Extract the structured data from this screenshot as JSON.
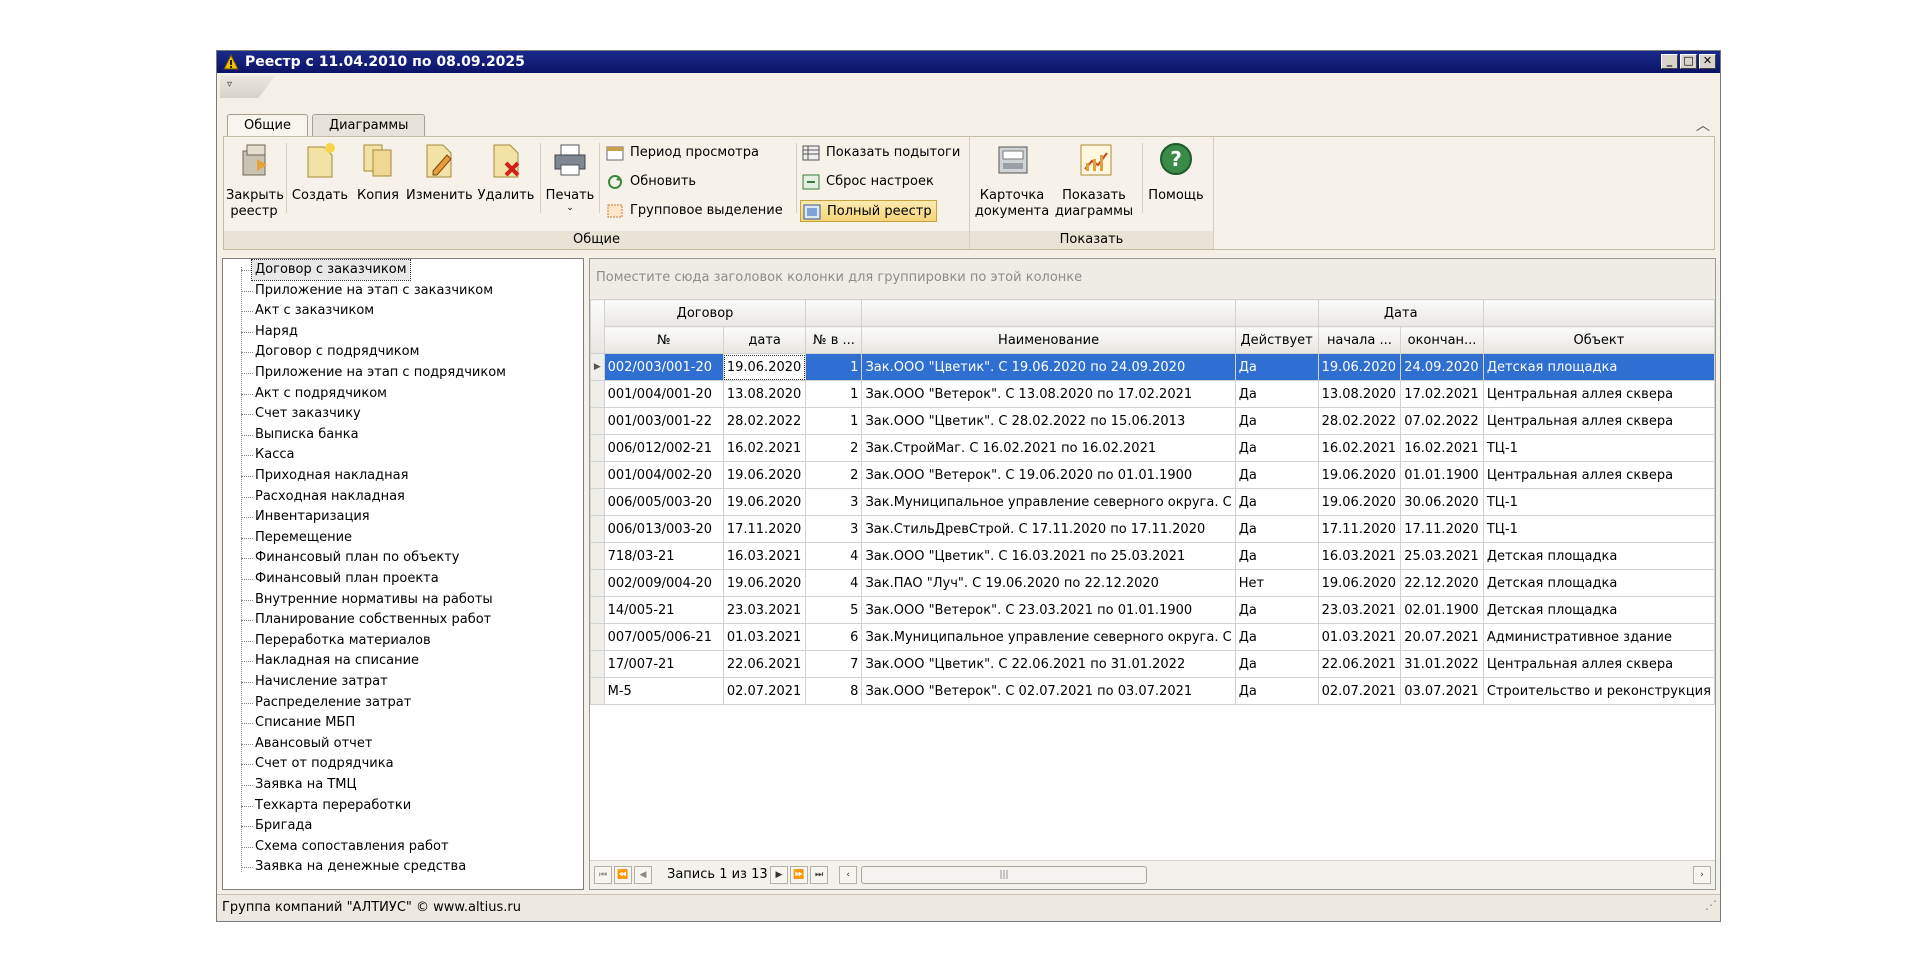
{
  "window": {
    "title": "Реестр с 11.04.2010 по 08.09.2025"
  },
  "ribbon": {
    "tabs": [
      "Общие",
      "Диаграммы"
    ],
    "groups": {
      "general": "Общие",
      "show": "Показать"
    },
    "buttons": {
      "close": "Закрыть реестр",
      "create": "Создать",
      "copy": "Копия",
      "edit": "Изменить",
      "delete": "Удалить",
      "print": "Печать",
      "period": "Период просмотра",
      "refresh": "Обновить",
      "group_select": "Групповое выделение",
      "totals": "Показать подытоги",
      "reset": "Сброс настроек",
      "full_registry": "Полный реестр",
      "card": "Карточка документа",
      "charts": "Показать диаграммы",
      "help": "Помощь"
    }
  },
  "tree": {
    "items": [
      "Договор с заказчиком",
      "Приложение на этап с заказчиком",
      "Акт с заказчиком",
      "Наряд",
      "Договор с подрядчиком",
      "Приложение на этап с подрядчиком",
      "Акт с подрядчиком",
      "Счет заказчику",
      "Выписка банка",
      "Касса",
      "Приходная накладная",
      "Расходная накладная",
      "Инвентаризация",
      "Перемещение",
      "Финансовый план по объекту",
      "Финансовый план проекта",
      "Внутренние нормативы на работы",
      "Планирование собственных работ",
      "Переработка материалов",
      "Накладная на списание",
      "Начисление затрат",
      "Распределение затрат",
      "Списание МБП",
      "Авансовый отчет",
      "Счет от подрядчика",
      "Заявка на ТМЦ",
      "Техкарта переработки",
      "Бригада",
      "Схема сопоставления работ",
      "Заявка на денежные средства"
    ],
    "selected_index": 0
  },
  "grid": {
    "group_panel_hint": "Поместите сюда заголовок колонки для группировки по этой колонке",
    "band_contract": "Договор",
    "band_date": "Дата",
    "columns": [
      "№",
      "дата",
      "№ в ...",
      "Наименование",
      "Действует",
      "начала ...",
      "окончан...",
      "Объект"
    ],
    "rows": [
      [
        "002/003/001-20",
        "19.06.2020",
        "1",
        "Зак.ООО \"Цветик\". С 19.06.2020 по 24.09.2020",
        "Да",
        "19.06.2020",
        "24.09.2020",
        "Детская площадка"
      ],
      [
        "001/004/001-20",
        "13.08.2020",
        "1",
        "Зак.ООО \"Ветерок\". С 13.08.2020 по 17.02.2021",
        "Да",
        "13.08.2020",
        "17.02.2021",
        "Центральная аллея сквера"
      ],
      [
        "001/003/001-22",
        "28.02.2022",
        "1",
        "Зак.ООО \"Цветик\". С 28.02.2022 по 15.06.2013",
        "Да",
        "28.02.2022",
        "07.02.2022",
        "Центральная аллея сквера"
      ],
      [
        "006/012/002-21",
        "16.02.2021",
        "2",
        "Зак.СтройМаг. С 16.02.2021 по 16.02.2021",
        "Да",
        "16.02.2021",
        "16.02.2021",
        "ТЦ-1"
      ],
      [
        "001/004/002-20",
        "19.06.2020",
        "2",
        "Зак.ООО \"Ветерок\". С 19.06.2020 по 01.01.1900",
        "Да",
        "19.06.2020",
        "01.01.1900",
        "Центральная аллея сквера"
      ],
      [
        "006/005/003-20",
        "19.06.2020",
        "3",
        "Зак.Муниципальное управление северного округа. С",
        "Да",
        "19.06.2020",
        "30.06.2020",
        "ТЦ-1"
      ],
      [
        "006/013/003-20",
        "17.11.2020",
        "3",
        "Зак.СтильДревСтрой. С 17.11.2020 по 17.11.2020",
        "Да",
        "17.11.2020",
        "17.11.2020",
        "ТЦ-1"
      ],
      [
        "718/03-21",
        "16.03.2021",
        "4",
        "Зак.ООО \"Цветик\". С 16.03.2021 по 25.03.2021",
        "Да",
        "16.03.2021",
        "25.03.2021",
        "Детская площадка"
      ],
      [
        "002/009/004-20",
        "19.06.2020",
        "4",
        "Зак.ПАО \"Луч\". С 19.06.2020 по 22.12.2020",
        "Нет",
        "19.06.2020",
        "22.12.2020",
        "Детская площадка"
      ],
      [
        "14/005-21",
        "23.03.2021",
        "5",
        "Зак.ООО \"Ветерок\". С 23.03.2021 по 01.01.1900",
        "Да",
        "23.03.2021",
        "02.01.1900",
        "Детская площадка"
      ],
      [
        "007/005/006-21",
        "01.03.2021",
        "6",
        "Зак.Муниципальное управление северного округа. С",
        "Да",
        "01.03.2021",
        "20.07.2021",
        "Административное здание"
      ],
      [
        "17/007-21",
        "22.06.2021",
        "7",
        "Зак.ООО \"Цветик\". С 22.06.2021 по 31.01.2022",
        "Да",
        "22.06.2021",
        "31.01.2022",
        "Центральная аллея сквера"
      ],
      [
        "М-5",
        "02.07.2021",
        "8",
        "Зак.ООО \"Ветерок\". С 02.07.2021 по 03.07.2021",
        "Да",
        "02.07.2021",
        "03.07.2021",
        "Строительство и реконструкция"
      ]
    ],
    "record_text": "Запись 1 из 13"
  },
  "status": {
    "text": "Группа компаний \"АЛТИУС\" © www.altius.ru"
  },
  "colors": {
    "titlebar": "#0b1468",
    "selected_row": "#2f6fd1",
    "ribbon_bg": "#f6f2ea"
  }
}
